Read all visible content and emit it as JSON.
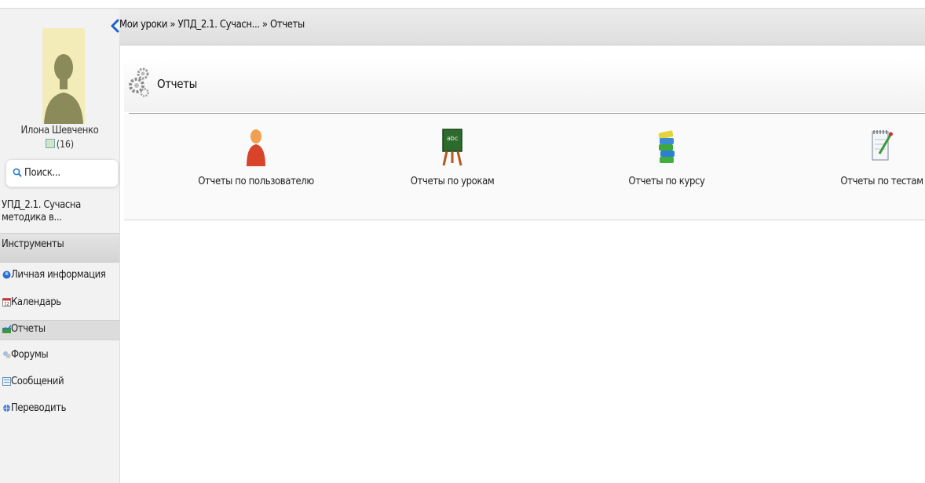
{
  "breadcrumb": {
    "text": "Мои уроки » УПД_2.1. Сучасн... » Отчеты"
  },
  "user": {
    "name": "Илона Шевченко",
    "messages": "(16)"
  },
  "search": {
    "placeholder": "Поиск..."
  },
  "course": {
    "title": "УПД_2.1. Сучасна методика в..."
  },
  "tools": {
    "label": "Инструменты"
  },
  "menu": {
    "items": [
      {
        "label": "Личная информация",
        "icon": "user-info-icon"
      },
      {
        "label": "Календарь",
        "icon": "calendar-icon"
      },
      {
        "label": "Отчеты",
        "icon": "reports-icon",
        "active": true
      },
      {
        "label": "Форумы",
        "icon": "forums-icon"
      },
      {
        "label": "Сообщений",
        "icon": "messages-icon"
      },
      {
        "label": "Переводить",
        "icon": "translate-icon"
      }
    ]
  },
  "page": {
    "title": "Отчеты"
  },
  "reports": [
    {
      "label": "Отчеты по пользователю",
      "icon": "user-icon"
    },
    {
      "label": "Отчеты по урокам",
      "icon": "chalkboard-icon"
    },
    {
      "label": "Отчеты по курсу",
      "icon": "books-icon"
    },
    {
      "label": "Отчеты по тестам",
      "icon": "notepad-icon"
    }
  ]
}
